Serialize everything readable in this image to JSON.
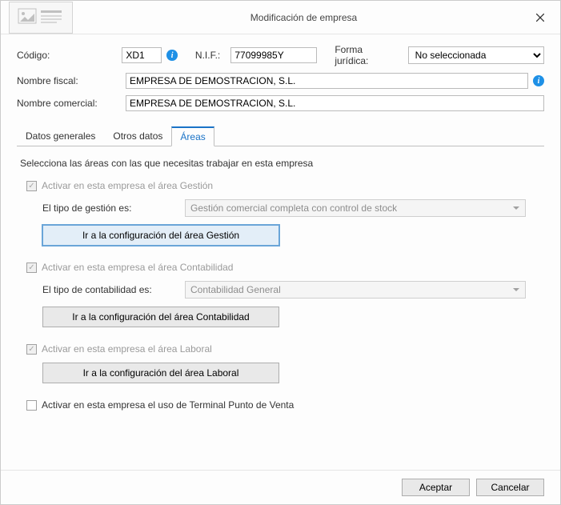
{
  "window": {
    "title": "Modificación de empresa"
  },
  "form": {
    "code_label": "Código:",
    "code_value": "XD1",
    "nif_label": "N.I.F.:",
    "nif_value": "77099985Y",
    "legalform_label": "Forma jurídica:",
    "legalform_value": "No seleccionada",
    "fiscalname_label": "Nombre fiscal:",
    "fiscalname_value": "EMPRESA DE DEMOSTRACION, S.L.",
    "commercialname_label": "Nombre comercial:",
    "commercialname_value": "EMPRESA DE DEMOSTRACION, S.L."
  },
  "tabs": {
    "general": "Datos generales",
    "other": "Otros datos",
    "areas": "Áreas"
  },
  "areas": {
    "intro": "Selecciona las áreas con las que necesitas trabajar en esta empresa",
    "gestion_check": "Activar en esta empresa el área Gestión",
    "gestion_type_label": "El tipo de gestión es:",
    "gestion_type_value": "Gestión comercial completa con control de stock",
    "gestion_button": "Ir a la configuración del área Gestión",
    "contab_check": "Activar en esta empresa el área Contabilidad",
    "contab_type_label": "El tipo de contabilidad es:",
    "contab_type_value": "Contabilidad General",
    "contab_button": "Ir a la configuración del área Contabilidad",
    "laboral_check": "Activar en esta empresa el área Laboral",
    "laboral_button": "Ir a la configuración del área Laboral",
    "tpv_check": "Activar en esta empresa el uso de Terminal Punto de Venta"
  },
  "footer": {
    "accept": "Aceptar",
    "cancel": "Cancelar"
  }
}
